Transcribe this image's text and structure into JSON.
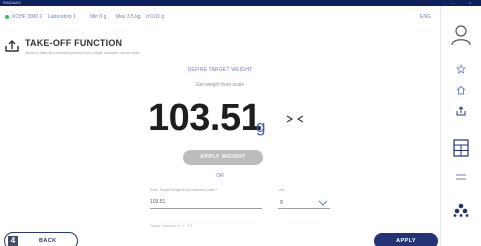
{
  "window": {
    "app_label": "RADWAG",
    "controls": [
      "–",
      "×"
    ]
  },
  "status_bar": {
    "items": [
      "XCHF 3000.1",
      "Laboratory 1",
      "Min 0 g",
      "Max 3.5 kg",
      "d 0.01 g"
    ],
    "language": "ENG"
  },
  "header": {
    "title": "TAKE-OFF FUNCTION",
    "subtitle": "Allows to take off a defined quantity from a single container via the scale",
    "icon": "upload-tray-icon"
  },
  "main": {
    "define_label": "DEFINE TARGET WEIGHT",
    "get_weight_label": "Get weight from scale",
    "reading": "103.51",
    "unit": "g",
    "stability_icon": "stability-icon",
    "apply_weight_label": "APPLY WEIGHT",
    "or_label": "OR",
    "target_field": {
      "label": "Enter Target Weight in the selected units",
      "required_mark": "*",
      "value": "103.51"
    },
    "unit_field": {
      "label": "Unit",
      "value": "g"
    },
    "percent_field": {
      "label": "Target Tolerance in +/- %",
      "required_mark": "*"
    }
  },
  "footer": {
    "back_number": "4",
    "back_label": "BACK",
    "apply_label": "APPLY"
  },
  "sidebar": {
    "icons": [
      "user-icon",
      "favorites-icon",
      "home-icon",
      "upload-icon",
      "calculator-icon",
      "transfer-icon",
      "network-icon"
    ]
  },
  "colors": {
    "titlebar": "#0d1f5c",
    "accent": "#3b55c4",
    "primary_button": "#233373",
    "disabled_button": "#bcbcbc",
    "status_dot": "#3dbb5c"
  }
}
